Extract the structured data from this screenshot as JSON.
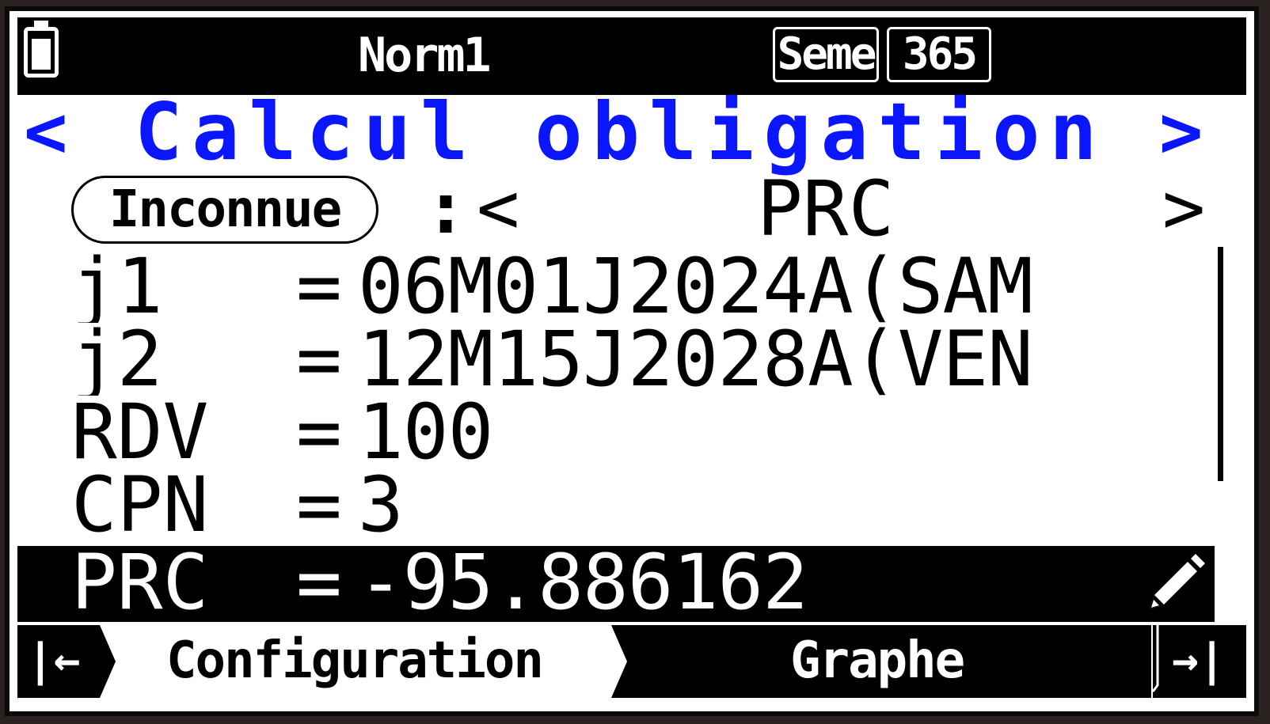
{
  "status": {
    "mode": "Norm1",
    "box1": "Seme",
    "box2": "365",
    "battery_level": 1.0
  },
  "title": {
    "left_arrow": "<",
    "text": "Calcul obligation",
    "right_arrow": ">"
  },
  "unknown": {
    "label": "Inconnue",
    "colon": ":",
    "left_arrow": "<",
    "value": "PRC",
    "right_arrow": ">"
  },
  "variables": [
    {
      "name": "j1",
      "eq": "=",
      "value": "06M01J2024A(SAM"
    },
    {
      "name": "j2",
      "eq": "=",
      "value": "12M15J2028A(VEN"
    },
    {
      "name": "RDV",
      "eq": "=",
      "value": "100"
    },
    {
      "name": "CPN",
      "eq": "=",
      "value": "3"
    },
    {
      "name": "PRC",
      "eq": "=",
      "value": "-95.886162"
    }
  ],
  "softkeys": {
    "first_icon": "|←",
    "configuration": "Configuration",
    "graph": "Graphe",
    "last_icon": "→|"
  },
  "colors": {
    "accent": "#0a16ff",
    "background": "#ffffff",
    "inverse": "#000000"
  }
}
